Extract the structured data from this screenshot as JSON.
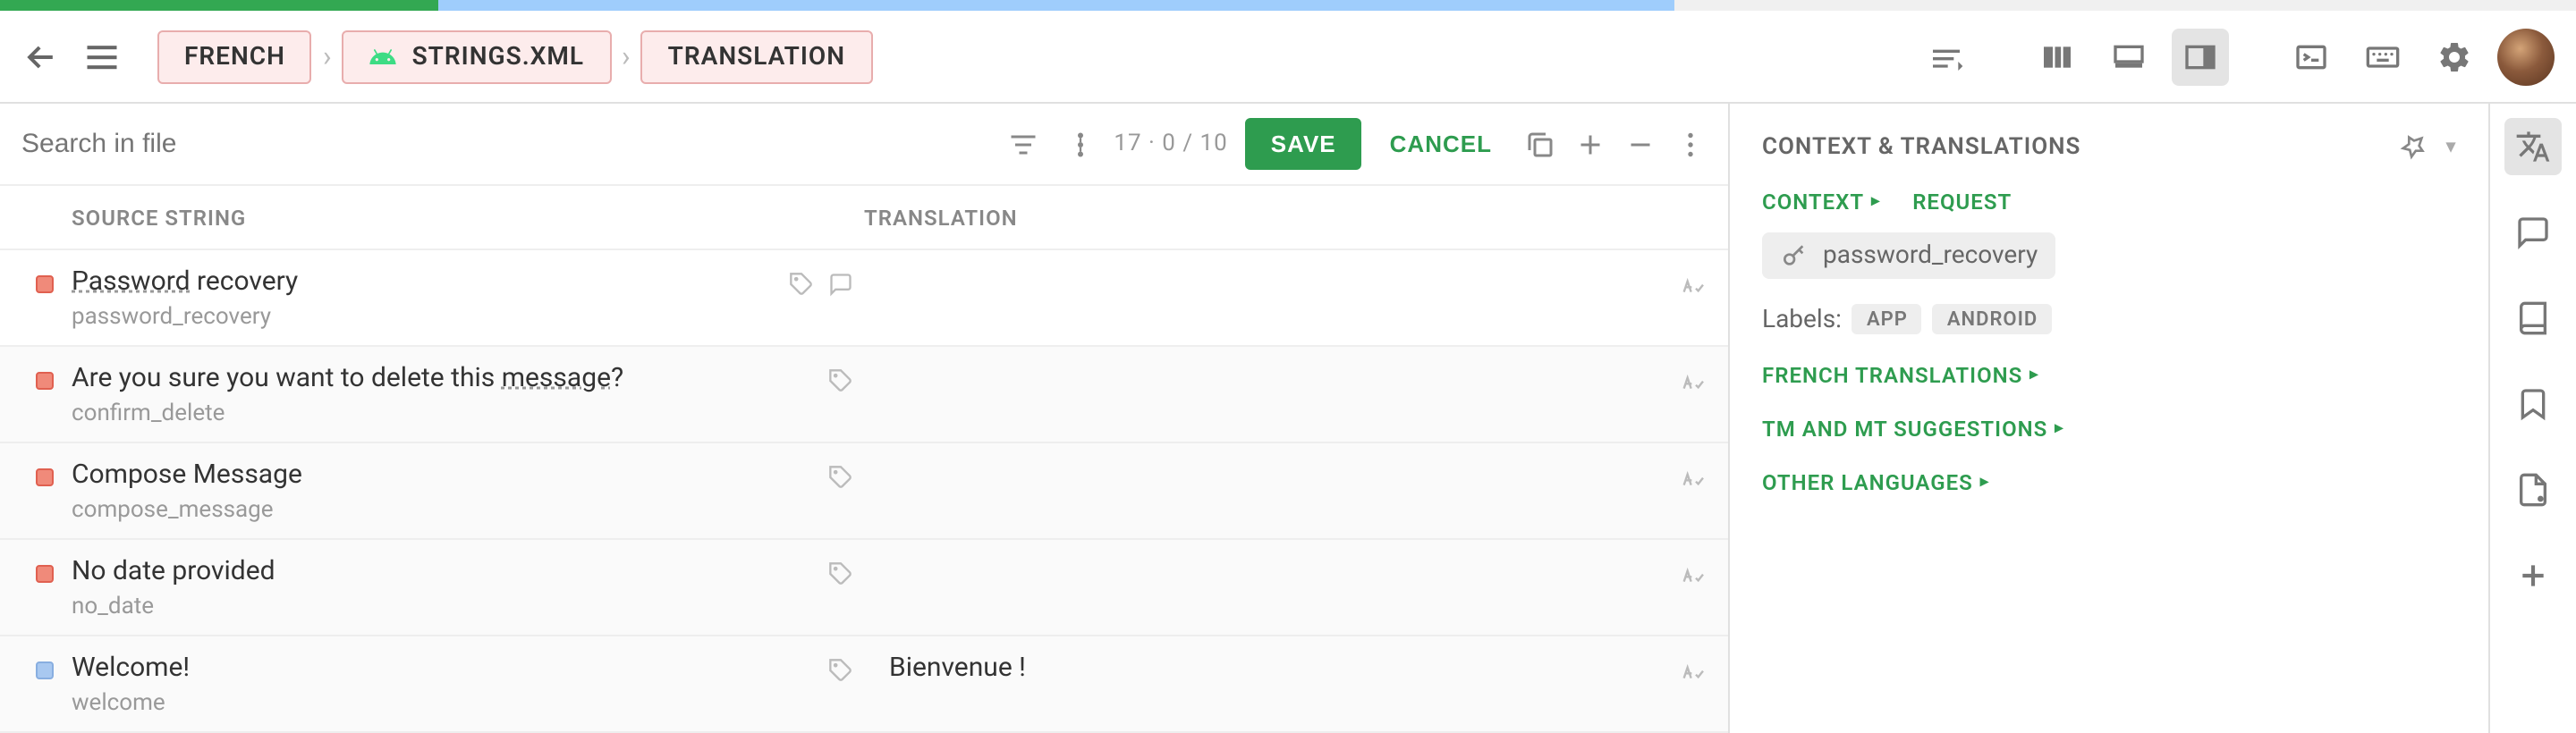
{
  "breadcrumb": {
    "lang": "FRENCH",
    "file": "STRINGS.XML",
    "mode": "TRANSLATION"
  },
  "toolbar": {
    "search_placeholder": "Search in file",
    "word_count": "17  ·  0 / 10",
    "save": "SAVE",
    "cancel": "CANCEL"
  },
  "columns": {
    "source": "SOURCE STRING",
    "translation": "TRANSLATION"
  },
  "rows": [
    {
      "status": "red",
      "source": "Password recovery",
      "key": "password_recovery",
      "translation": "",
      "has_comment": true,
      "underlined_word": "Password"
    },
    {
      "status": "red",
      "source": "Are you sure you want to delete this message?",
      "key": "confirm_delete",
      "translation": "",
      "underlined_word": "message"
    },
    {
      "status": "red",
      "source": "Compose Message",
      "key": "compose_message",
      "translation": ""
    },
    {
      "status": "red",
      "source": "No date provided",
      "key": "no_date",
      "translation": ""
    },
    {
      "status": "grey",
      "source": "Welcome!",
      "key": "welcome",
      "translation": "Bienvenue !"
    }
  ],
  "context": {
    "title": "CONTEXT & TRANSLATIONS",
    "tab_context": "CONTEXT",
    "tab_request": "REQUEST",
    "key_name": "password_recovery",
    "labels_label": "Labels:",
    "labels": [
      "APP",
      "ANDROID"
    ],
    "section_french": "FRENCH TRANSLATIONS",
    "section_tm": "TM AND MT SUGGESTIONS",
    "section_other": "OTHER LANGUAGES"
  }
}
